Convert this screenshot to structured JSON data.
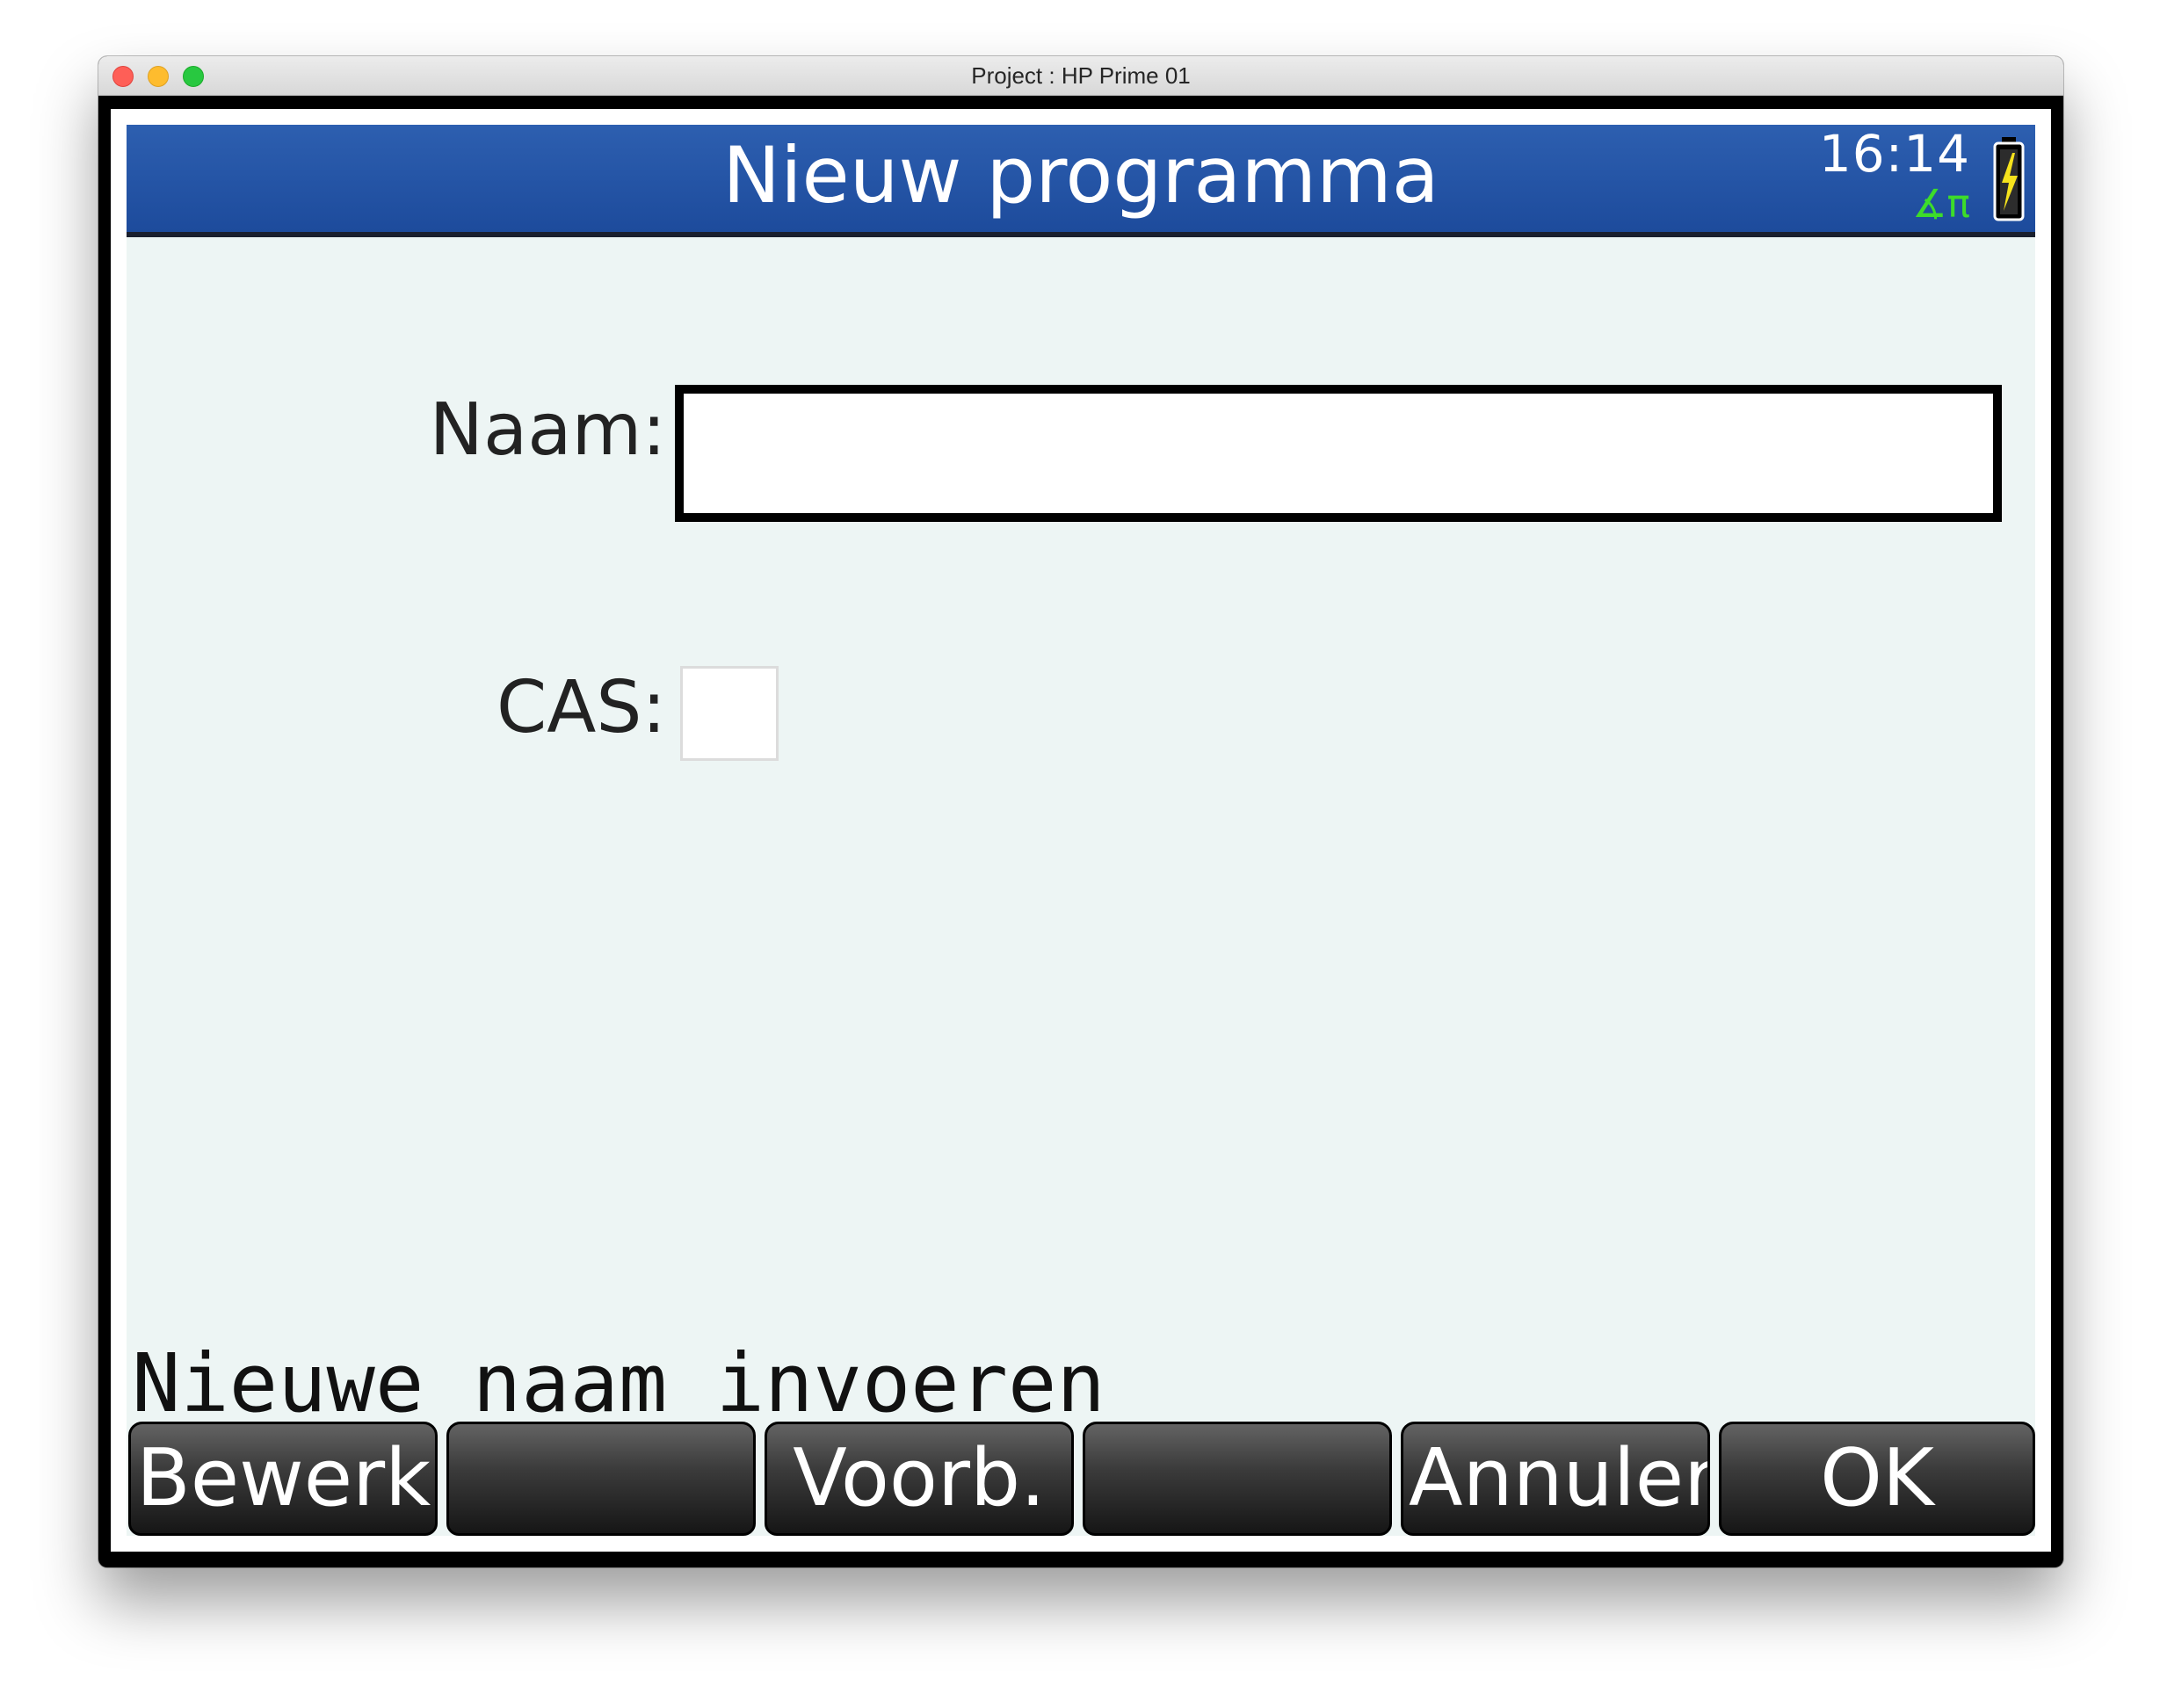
{
  "window": {
    "title": "Project : HP Prime 01"
  },
  "header": {
    "title": "Nieuw programma",
    "clock": "16:14",
    "angle_mode": "∡π",
    "battery_icon": "battery-charging-icon",
    "colors": {
      "bar": "#2357a8",
      "angle_mode": "#3ddc2a",
      "battery_bolt": "#f5e21c"
    }
  },
  "form": {
    "name_label": "Naam:",
    "name_value": "",
    "cas_label": "CAS:",
    "cas_checked": false
  },
  "hint": "Nieuwe naam invoeren",
  "softkeys": [
    {
      "label": "Bewerk"
    },
    {
      "label": ""
    },
    {
      "label": "Voorb."
    },
    {
      "label": ""
    },
    {
      "label": "Annuler"
    },
    {
      "label": "OK"
    }
  ]
}
